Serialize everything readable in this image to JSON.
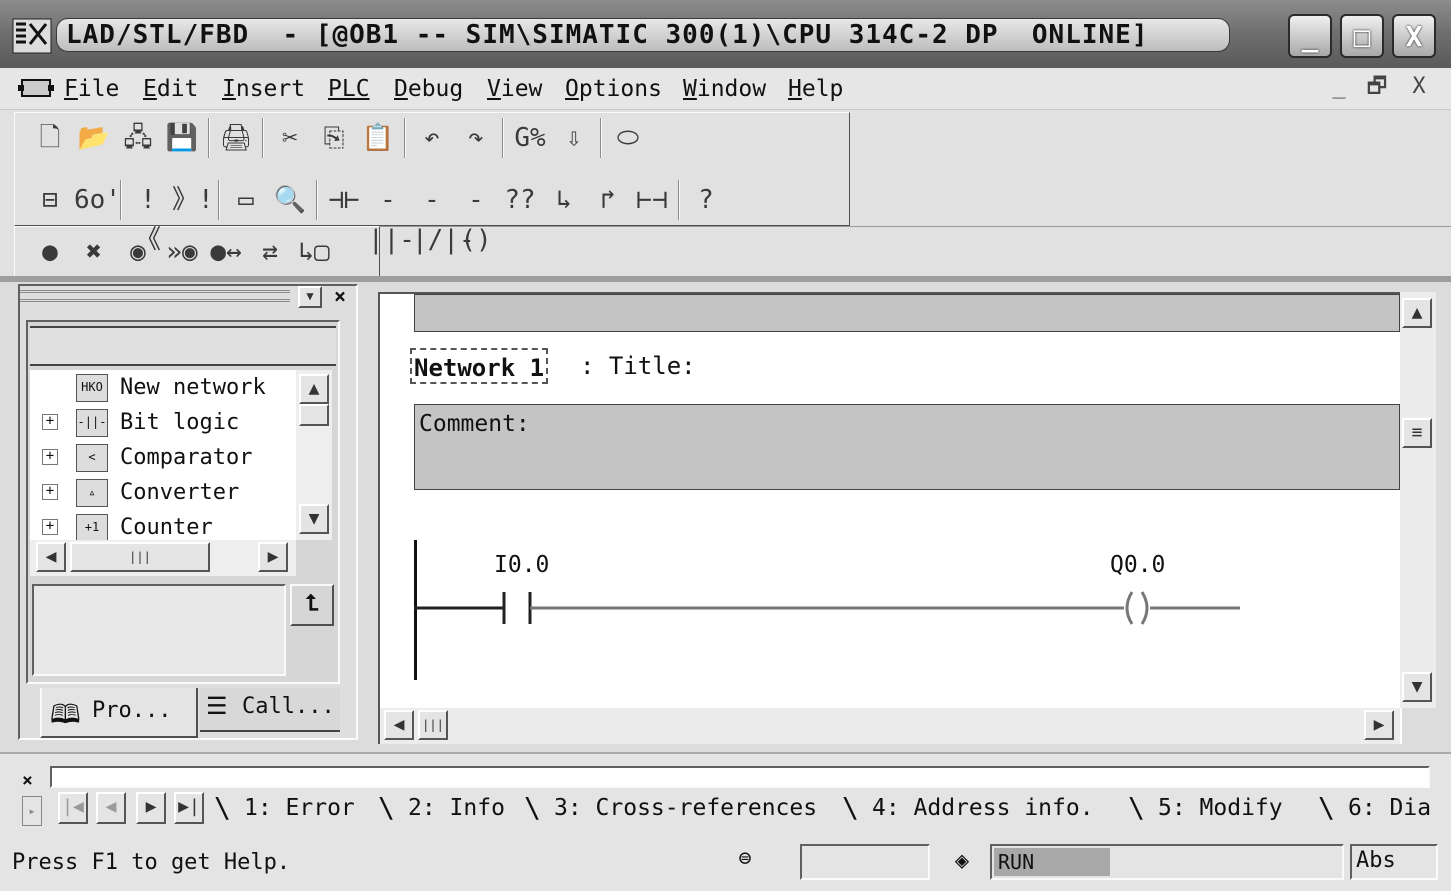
{
  "window": {
    "title": "LAD/STL/FBD  - [@OB1 -- SIM\\SIMATIC 300(1)\\CPU 314C-2 DP  ONLINE]",
    "min": "_",
    "max": "□",
    "close": "X"
  },
  "menu": {
    "items": [
      {
        "key": "F",
        "rest": "ile"
      },
      {
        "key": "E",
        "rest": "dit"
      },
      {
        "key": "I",
        "rest": "nsert"
      },
      {
        "key": "",
        "rest": "PLC"
      },
      {
        "key": "D",
        "rest": "ebug"
      },
      {
        "key": "V",
        "rest": "iew"
      },
      {
        "key": "O",
        "rest": "ptions"
      },
      {
        "key": "W",
        "rest": "indow"
      },
      {
        "key": "H",
        "rest": "elp"
      }
    ],
    "mdi_min": "_",
    "mdi_restore": "🗗",
    "mdi_close": "X"
  },
  "toolbar": {
    "row1": [
      "🗋",
      "📂",
      "🖧",
      "💾",
      "|",
      "🖨",
      "|",
      "✂",
      "⎘",
      "📋",
      "|",
      "↶",
      "↷",
      "|",
      "G%",
      "⇩",
      "|",
      "⬭"
    ],
    "row2": [
      "⊟",
      "6o'",
      "|",
      "!《",
      "》!",
      "|",
      "▭",
      "🔍",
      "|",
      "⊣⊢",
      "-||-",
      "-|/|-",
      "-()",
      "??",
      "↳",
      "↱",
      "⊢⊣",
      "|",
      "?"
    ],
    "row3": [
      "●",
      "✖",
      "◉",
      "»◉",
      "●↔",
      "⇄",
      "↳▢"
    ]
  },
  "left_panel": {
    "tree": [
      {
        "label": "New network",
        "icon": "HKO"
      },
      {
        "label": "Bit logic",
        "icon": "-||-",
        "expand": "+"
      },
      {
        "label": "Comparator",
        "icon": "<",
        "expand": "+"
      },
      {
        "label": "Converter",
        "icon": "▵",
        "expand": "+"
      },
      {
        "label": "Counter",
        "icon": "+1",
        "expand": "+"
      }
    ],
    "tabs": [
      {
        "label": "Pro..."
      },
      {
        "label": "Call..."
      }
    ]
  },
  "editor": {
    "network_label": "Network 1",
    "network_title": ": Title:",
    "comment_label": "Comment:",
    "contact_address": "I0.0",
    "coil_address": "Q0.0"
  },
  "output_tabs": [
    "1: Error",
    "2: Info",
    "3: Cross-references",
    "4: Address info.",
    "5: Modify",
    "6: Dia"
  ],
  "status": {
    "help_text": "Press F1 to get Help.",
    "mode": "RUN",
    "addr_mode": "Abs"
  }
}
